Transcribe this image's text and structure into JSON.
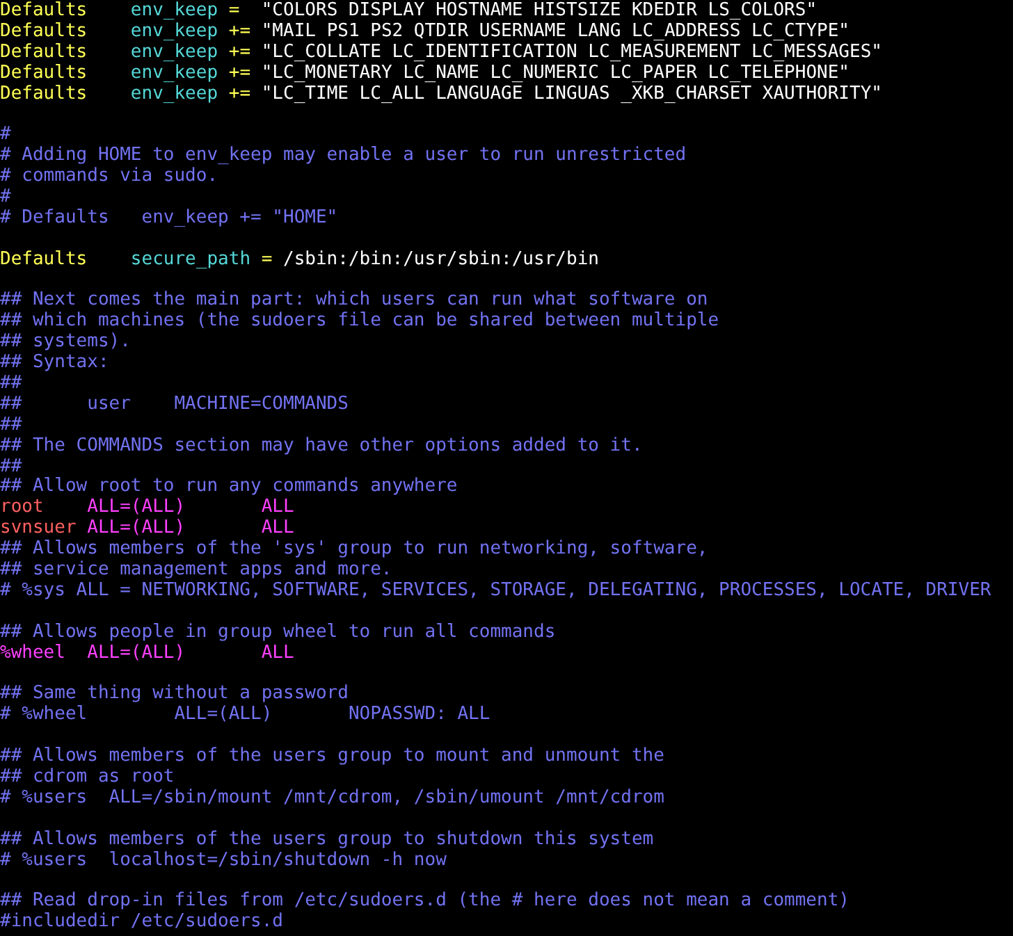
{
  "editor": {
    "lines": [
      {
        "kind": "code",
        "segments": [
          {
            "kind": "keyword",
            "text": "Defaults    "
          },
          {
            "kind": "option",
            "text": "env_keep "
          },
          {
            "kind": "operator",
            "text": "=  "
          },
          {
            "kind": "string",
            "text": "\"COLORS DISPLAY HOSTNAME HISTSIZE KDEDIR LS_COLORS\""
          }
        ]
      },
      {
        "kind": "code",
        "segments": [
          {
            "kind": "keyword",
            "text": "Defaults    "
          },
          {
            "kind": "option",
            "text": "env_keep "
          },
          {
            "kind": "operator",
            "text": "+= "
          },
          {
            "kind": "string",
            "text": "\"MAIL PS1 PS2 QTDIR USERNAME LANG LC_ADDRESS LC_CTYPE\""
          }
        ]
      },
      {
        "kind": "code",
        "segments": [
          {
            "kind": "keyword",
            "text": "Defaults    "
          },
          {
            "kind": "option",
            "text": "env_keep "
          },
          {
            "kind": "operator",
            "text": "+= "
          },
          {
            "kind": "string",
            "text": "\"LC_COLLATE LC_IDENTIFICATION LC_MEASUREMENT LC_MESSAGES\""
          }
        ]
      },
      {
        "kind": "code",
        "segments": [
          {
            "kind": "keyword",
            "text": "Defaults    "
          },
          {
            "kind": "option",
            "text": "env_keep "
          },
          {
            "kind": "operator",
            "text": "+= "
          },
          {
            "kind": "string",
            "text": "\"LC_MONETARY LC_NAME LC_NUMERIC LC_PAPER LC_TELEPHONE\""
          }
        ]
      },
      {
        "kind": "code",
        "segments": [
          {
            "kind": "keyword",
            "text": "Defaults    "
          },
          {
            "kind": "option",
            "text": "env_keep "
          },
          {
            "kind": "operator",
            "text": "+= "
          },
          {
            "kind": "string",
            "text": "\"LC_TIME LC_ALL LANGUAGE LINGUAS _XKB_CHARSET XAUTHORITY\""
          }
        ]
      },
      {
        "kind": "blank"
      },
      {
        "kind": "code",
        "segments": [
          {
            "kind": "comment",
            "text": "#"
          }
        ]
      },
      {
        "kind": "code",
        "segments": [
          {
            "kind": "comment",
            "text": "# Adding HOME to env_keep may enable a user to run unrestricted"
          }
        ]
      },
      {
        "kind": "code",
        "segments": [
          {
            "kind": "comment",
            "text": "# commands via sudo."
          }
        ]
      },
      {
        "kind": "code",
        "segments": [
          {
            "kind": "comment",
            "text": "#"
          }
        ]
      },
      {
        "kind": "code",
        "segments": [
          {
            "kind": "comment",
            "text": "# Defaults   env_keep += \"HOME\""
          }
        ]
      },
      {
        "kind": "blank"
      },
      {
        "kind": "code",
        "segments": [
          {
            "kind": "keyword",
            "text": "Defaults    "
          },
          {
            "kind": "option",
            "text": "secure_path "
          },
          {
            "kind": "operator",
            "text": "= "
          },
          {
            "kind": "string",
            "text": "/sbin:/bin:/usr/sbin:/usr/bin"
          }
        ]
      },
      {
        "kind": "blank"
      },
      {
        "kind": "code",
        "segments": [
          {
            "kind": "comment",
            "text": "## Next comes the main part: which users can run what software on"
          }
        ]
      },
      {
        "kind": "code",
        "segments": [
          {
            "kind": "comment",
            "text": "## which machines (the sudoers file can be shared between multiple"
          }
        ]
      },
      {
        "kind": "code",
        "segments": [
          {
            "kind": "comment",
            "text": "## systems)."
          }
        ]
      },
      {
        "kind": "code",
        "segments": [
          {
            "kind": "comment",
            "text": "## Syntax:"
          }
        ]
      },
      {
        "kind": "code",
        "segments": [
          {
            "kind": "comment",
            "text": "##"
          }
        ]
      },
      {
        "kind": "code",
        "segments": [
          {
            "kind": "comment",
            "text": "##      user    MACHINE=COMMANDS"
          }
        ]
      },
      {
        "kind": "code",
        "segments": [
          {
            "kind": "comment",
            "text": "##"
          }
        ]
      },
      {
        "kind": "code",
        "segments": [
          {
            "kind": "comment",
            "text": "## The COMMANDS section may have other options added to it."
          }
        ]
      },
      {
        "kind": "code",
        "segments": [
          {
            "kind": "comment",
            "text": "##"
          }
        ]
      },
      {
        "kind": "code",
        "segments": [
          {
            "kind": "comment",
            "text": "## Allow root to run any commands anywhere"
          }
        ]
      },
      {
        "kind": "code",
        "segments": [
          {
            "kind": "user",
            "text": "root    "
          },
          {
            "kind": "spec",
            "text": "ALL=(ALL)       ALL"
          }
        ]
      },
      {
        "kind": "code",
        "segments": [
          {
            "kind": "user",
            "text": "svnsuer "
          },
          {
            "kind": "spec",
            "text": "ALL=(ALL)       ALL"
          }
        ]
      },
      {
        "kind": "code",
        "segments": [
          {
            "kind": "comment",
            "text": "## Allows members of the 'sys' group to run networking, software,"
          }
        ]
      },
      {
        "kind": "code",
        "segments": [
          {
            "kind": "comment",
            "text": "## service management apps and more."
          }
        ]
      },
      {
        "kind": "code",
        "segments": [
          {
            "kind": "comment",
            "text": "# %sys ALL = NETWORKING, SOFTWARE, SERVICES, STORAGE, DELEGATING, PROCESSES, LOCATE, DRIVER"
          }
        ]
      },
      {
        "kind": "blank"
      },
      {
        "kind": "code",
        "segments": [
          {
            "kind": "comment",
            "text": "## Allows people in group wheel to run all commands"
          }
        ]
      },
      {
        "kind": "code",
        "segments": [
          {
            "kind": "spec",
            "text": "%wheel  ALL=(ALL)       ALL"
          }
        ]
      },
      {
        "kind": "blank"
      },
      {
        "kind": "code",
        "segments": [
          {
            "kind": "comment",
            "text": "## Same thing without a password"
          }
        ]
      },
      {
        "kind": "code",
        "segments": [
          {
            "kind": "comment",
            "text": "# %wheel        ALL=(ALL)       NOPASSWD: ALL"
          }
        ]
      },
      {
        "kind": "blank"
      },
      {
        "kind": "code",
        "segments": [
          {
            "kind": "comment",
            "text": "## Allows members of the users group to mount and unmount the"
          }
        ]
      },
      {
        "kind": "code",
        "segments": [
          {
            "kind": "comment",
            "text": "## cdrom as root"
          }
        ]
      },
      {
        "kind": "code",
        "segments": [
          {
            "kind": "comment",
            "text": "# %users  ALL=/sbin/mount /mnt/cdrom, /sbin/umount /mnt/cdrom"
          }
        ]
      },
      {
        "kind": "blank"
      },
      {
        "kind": "code",
        "segments": [
          {
            "kind": "comment",
            "text": "## Allows members of the users group to shutdown this system"
          }
        ]
      },
      {
        "kind": "code",
        "segments": [
          {
            "kind": "comment",
            "text": "# %users  localhost=/sbin/shutdown -h now"
          }
        ]
      },
      {
        "kind": "blank"
      },
      {
        "kind": "code",
        "segments": [
          {
            "kind": "comment",
            "text": "## Read drop-in files from /etc/sudoers.d (the # here does not mean a comment)"
          }
        ]
      },
      {
        "kind": "code",
        "segments": [
          {
            "kind": "comment",
            "text": "#includedir /etc/sudoers.d"
          }
        ]
      }
    ]
  }
}
